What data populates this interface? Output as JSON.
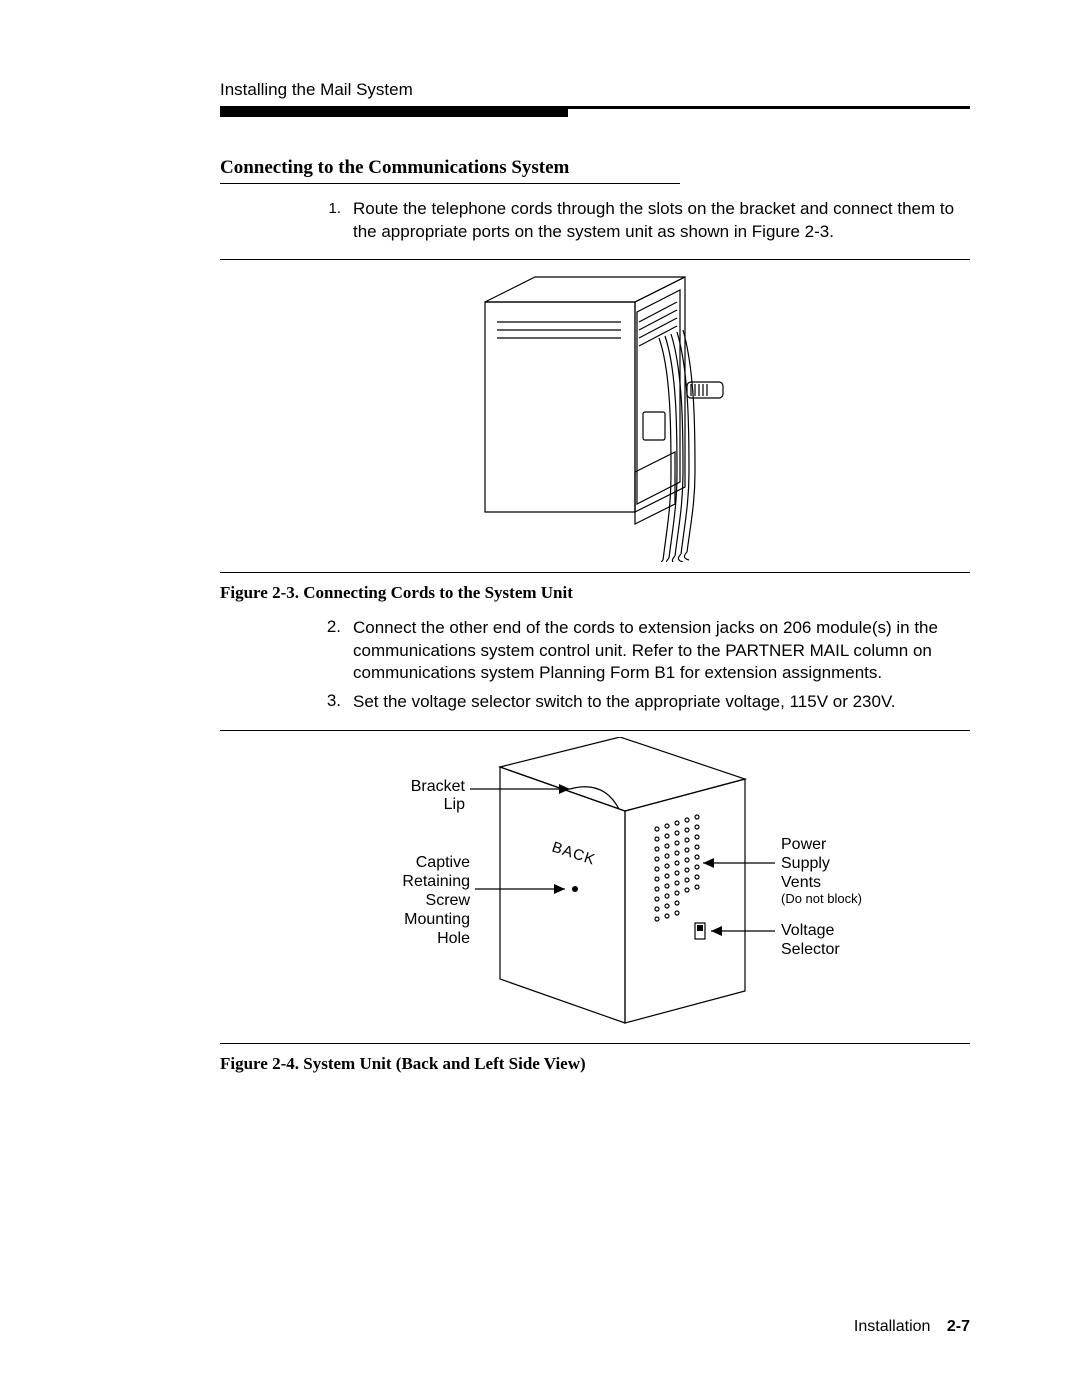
{
  "running_head": "Installing the Mail System",
  "section_title": "Connecting to the Communications System",
  "steps": {
    "s1_num": "1.",
    "s1_text": "Route the telephone cords through the slots on the bracket and connect them to the appropriate ports on the system unit as shown in Figure 2-3.",
    "s2_num": "2.",
    "s2_text": "Connect the other end of the cords to extension jacks on 206 module(s) in the communications system control unit. Refer to the PARTNER MAIL column on communications system Planning Form B1 for extension assignments.",
    "s3_num": "3.",
    "s3_text": "Set the voltage selector switch to the appropriate voltage, 115V or 230V."
  },
  "fig1": {
    "caption": "Figure 2-3. Connecting Cords to the System Unit"
  },
  "fig2": {
    "caption": "Figure 2-4. System Unit (Back and Left Side View)",
    "labels": {
      "bracket_lip_1": "Bracket",
      "bracket_lip_2": "Lip",
      "captive_1": "Captive",
      "captive_2": "Retaining",
      "captive_3": "Screw",
      "captive_4": "Mounting",
      "captive_5": "Hole",
      "back_word": "BACK",
      "psu_1": "Power",
      "psu_2": "Supply",
      "psu_3": "Vents",
      "psu_note": "(Do not block)",
      "volt_1": "Voltage",
      "volt_2": "Selector"
    }
  },
  "footer": {
    "chapter": "Installation",
    "page": "2-7"
  }
}
